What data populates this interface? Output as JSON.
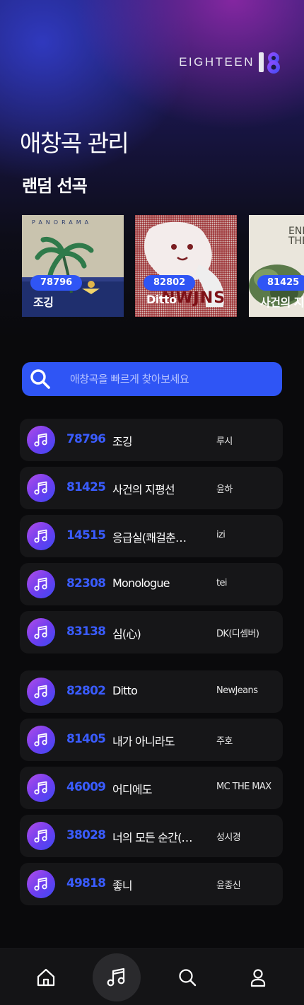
{
  "brand": {
    "logo_text": "EIGHTEEN",
    "logo_mark": "18"
  },
  "page_title": "애창곡 관리",
  "random_section": {
    "title": "랜덤 선곡",
    "albums": [
      {
        "number": "78796",
        "title": "조깅",
        "art_text": "PANORAMA"
      },
      {
        "number": "82802",
        "title": "Ditto",
        "art_text": "NWJNS"
      },
      {
        "number": "81425",
        "title": "사건의 지평선",
        "art_text": "END THEO"
      }
    ]
  },
  "search": {
    "placeholder": "애창곡을 빠르게 찾아보세요",
    "value": ""
  },
  "songs": [
    {
      "number": "78796",
      "title": "조깅",
      "artist": "루시"
    },
    {
      "number": "81425",
      "title": "사건의 지평선",
      "artist": "윤하"
    },
    {
      "number": "14515",
      "title": "응급실(쾌걸춘향…",
      "artist": "izi"
    },
    {
      "number": "82308",
      "title": "Monologue",
      "artist": "tei"
    },
    {
      "number": "83138",
      "title": "심(心)",
      "artist": "DK(디셈버)"
    },
    {
      "number": "82802",
      "title": "Ditto",
      "artist": "NewJeans"
    },
    {
      "number": "81405",
      "title": "내가 아니라도",
      "artist": "주호"
    },
    {
      "number": "46009",
      "title": "어디에도",
      "artist": "MC THE MAX"
    },
    {
      "number": "38028",
      "title": "너의 모든 순간(별…",
      "artist": "성시경"
    },
    {
      "number": "49818",
      "title": "좋니",
      "artist": "윤종신"
    }
  ],
  "bottom_nav": {
    "items": [
      {
        "icon": "home-icon"
      },
      {
        "icon": "music-note-icon",
        "active": true
      },
      {
        "icon": "search-icon"
      },
      {
        "icon": "user-icon"
      }
    ]
  },
  "colors": {
    "accent": "#2f55f5",
    "number": "#3a5cff",
    "row_bg": "#161618"
  }
}
